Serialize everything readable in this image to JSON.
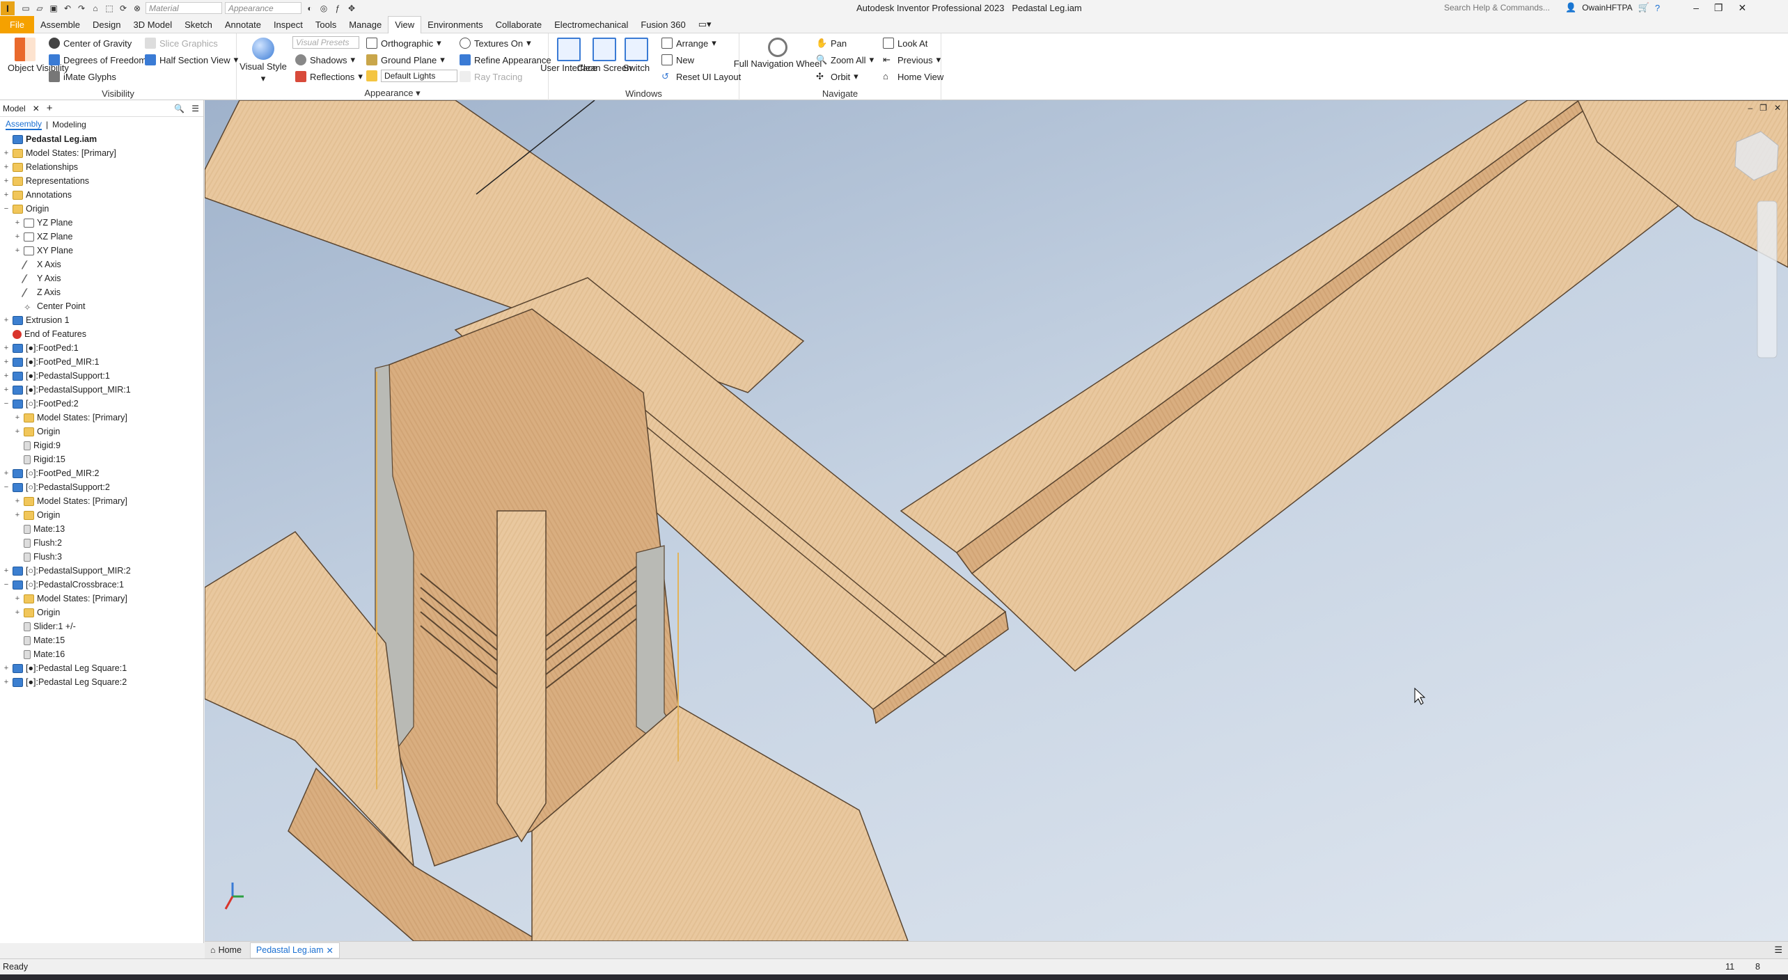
{
  "titlebar": {
    "app_letter": "I",
    "material_placeholder": "Material",
    "appearance_placeholder": "Appearance",
    "app_title": "Autodesk Inventor Professional 2023",
    "document_name": "Pedastal Leg.iam",
    "search_placeholder": "Search Help & Commands...",
    "user": "OwainHFTPA"
  },
  "menu": {
    "tabs": [
      "File",
      "Assemble",
      "Design",
      "3D Model",
      "Sketch",
      "Annotate",
      "Inspect",
      "Tools",
      "Manage",
      "View",
      "Environments",
      "Collaborate",
      "Electromechanical",
      "Fusion 360"
    ],
    "active": "View"
  },
  "ribbon": {
    "visibility": {
      "label": "Visibility",
      "object_visibility": "Object Visibility",
      "center_of_gravity": "Center of Gravity",
      "degrees_of_freedom": "Degrees of Freedom",
      "imate_glyphs": "iMate Glyphs",
      "slice_graphics": "Slice Graphics",
      "half_section_view": "Half Section View"
    },
    "appearance": {
      "label": "Appearance",
      "visual_style": "Visual Style",
      "visual_presets": "Visual Presets",
      "shadows": "Shadows",
      "reflections": "Reflections",
      "orthographic": "Orthographic",
      "ground_plane": "Ground Plane",
      "default_lights": "Default Lights",
      "textures_on": "Textures On",
      "refine_appearance": "Refine Appearance",
      "ray_tracing": "Ray Tracing"
    },
    "windows": {
      "label": "Windows",
      "user_interface": "User Interface",
      "clean_screen": "Clean Screen",
      "switch": "Switch",
      "arrange": "Arrange",
      "new": "New",
      "reset_ui_layout": "Reset UI Layout"
    },
    "navigate": {
      "label": "Navigate",
      "full_navigation_wheel": "Full Navigation Wheel",
      "pan": "Pan",
      "zoom_all": "Zoom All",
      "orbit": "Orbit",
      "look_at": "Look At",
      "previous": "Previous",
      "home_view": "Home View"
    }
  },
  "browser": {
    "tab": "Model",
    "add": "+",
    "sub_assembly": "Assembly",
    "sub_modeling": "Modeling",
    "tree": [
      {
        "label": "Pedastal Leg.iam",
        "icon": "assembly",
        "indent": 0,
        "exp": ""
      },
      {
        "label": "Model States: [Primary]",
        "icon": "folder",
        "indent": 0,
        "exp": "+"
      },
      {
        "label": "Relationships",
        "icon": "folder",
        "indent": 0,
        "exp": "+"
      },
      {
        "label": "Representations",
        "icon": "folder",
        "indent": 0,
        "exp": "+"
      },
      {
        "label": "Annotations",
        "icon": "folder",
        "indent": 0,
        "exp": "+"
      },
      {
        "label": "Origin",
        "icon": "folder",
        "indent": 0,
        "exp": "−"
      },
      {
        "label": "YZ Plane",
        "icon": "plane",
        "indent": 1,
        "exp": "+"
      },
      {
        "label": "XZ Plane",
        "icon": "plane",
        "indent": 1,
        "exp": "+"
      },
      {
        "label": "XY Plane",
        "icon": "plane",
        "indent": 1,
        "exp": "+"
      },
      {
        "label": "X Axis",
        "icon": "axis",
        "indent": 1,
        "exp": ""
      },
      {
        "label": "Y Axis",
        "icon": "axis",
        "indent": 1,
        "exp": ""
      },
      {
        "label": "Z Axis",
        "icon": "axis",
        "indent": 1,
        "exp": ""
      },
      {
        "label": "Center Point",
        "icon": "pt",
        "indent": 1,
        "exp": ""
      },
      {
        "label": "Extrusion 1",
        "icon": "part",
        "indent": 0,
        "exp": "+"
      },
      {
        "label": "End of Features",
        "icon": "err",
        "indent": 0,
        "exp": ""
      },
      {
        "label": "[●]:FootPed:1",
        "icon": "part",
        "indent": 0,
        "exp": "+"
      },
      {
        "label": "[●]:FootPed_MIR:1",
        "icon": "part",
        "indent": 0,
        "exp": "+"
      },
      {
        "label": "[●]:PedastalSupport:1",
        "icon": "part",
        "indent": 0,
        "exp": "+"
      },
      {
        "label": "[●]:PedastalSupport_MIR:1",
        "icon": "part",
        "indent": 0,
        "exp": "+"
      },
      {
        "label": "[○]:FootPed:2",
        "icon": "part",
        "indent": 0,
        "exp": "−"
      },
      {
        "label": "Model States: [Primary]",
        "icon": "folder",
        "indent": 1,
        "exp": "+"
      },
      {
        "label": "Origin",
        "icon": "folder",
        "indent": 1,
        "exp": "+"
      },
      {
        "label": "Rigid:9",
        "icon": "con",
        "indent": 1,
        "exp": ""
      },
      {
        "label": "Rigid:15",
        "icon": "con",
        "indent": 1,
        "exp": ""
      },
      {
        "label": "[○]:FootPed_MIR:2",
        "icon": "part",
        "indent": 0,
        "exp": "+"
      },
      {
        "label": "[○]:PedastalSupport:2",
        "icon": "part",
        "indent": 0,
        "exp": "−"
      },
      {
        "label": "Model States: [Primary]",
        "icon": "folder",
        "indent": 1,
        "exp": "+"
      },
      {
        "label": "Origin",
        "icon": "folder",
        "indent": 1,
        "exp": "+"
      },
      {
        "label": "Mate:13",
        "icon": "con",
        "indent": 1,
        "exp": ""
      },
      {
        "label": "Flush:2",
        "icon": "con",
        "indent": 1,
        "exp": ""
      },
      {
        "label": "Flush:3",
        "icon": "con",
        "indent": 1,
        "exp": ""
      },
      {
        "label": "[○]:PedastalSupport_MIR:2",
        "icon": "part",
        "indent": 0,
        "exp": "+"
      },
      {
        "label": "[○]:PedastalCrossbrace:1",
        "icon": "part",
        "indent": 0,
        "exp": "−"
      },
      {
        "label": "Model States: [Primary]",
        "icon": "folder",
        "indent": 1,
        "exp": "+"
      },
      {
        "label": "Origin",
        "icon": "folder",
        "indent": 1,
        "exp": "+"
      },
      {
        "label": "Slider:1 +/-",
        "icon": "con",
        "indent": 1,
        "exp": ""
      },
      {
        "label": "Mate:15",
        "icon": "con",
        "indent": 1,
        "exp": ""
      },
      {
        "label": "Mate:16",
        "icon": "con",
        "indent": 1,
        "exp": ""
      },
      {
        "label": "[●]:Pedastal Leg Square:1",
        "icon": "part",
        "indent": 0,
        "exp": "+"
      },
      {
        "label": "[●]:Pedastal Leg Square:2",
        "icon": "part",
        "indent": 0,
        "exp": "+"
      }
    ]
  },
  "doc_tabs": {
    "home": "Home",
    "active": "Pedastal Leg.iam"
  },
  "status": {
    "text": "Ready",
    "count1": "11",
    "count2": "8"
  },
  "colors": {
    "accent": "#f5a100",
    "wood": "#e7c49a",
    "wood_dark": "#cfa577",
    "select_blue": "#1a6fd1"
  }
}
